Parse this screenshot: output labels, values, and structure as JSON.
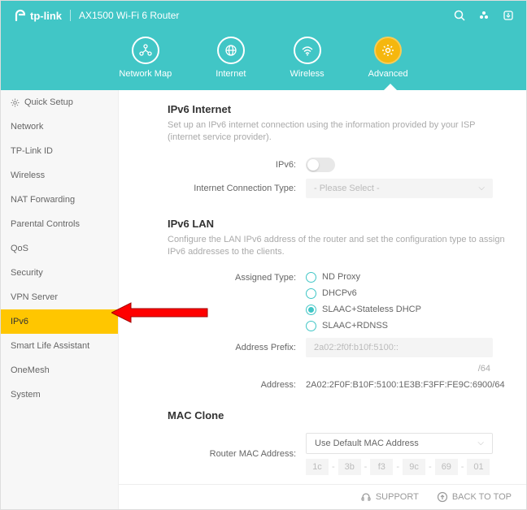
{
  "brand": "tp-link",
  "product": "AX1500 Wi-Fi 6 Router",
  "tabs": {
    "network_map": "Network Map",
    "internet": "Internet",
    "wireless": "Wireless",
    "advanced": "Advanced"
  },
  "sidebar": {
    "items": [
      {
        "label": "Quick Setup",
        "icon": true
      },
      {
        "label": "Network"
      },
      {
        "label": "TP-Link ID"
      },
      {
        "label": "Wireless"
      },
      {
        "label": "NAT Forwarding"
      },
      {
        "label": "Parental Controls"
      },
      {
        "label": "QoS"
      },
      {
        "label": "Security"
      },
      {
        "label": "VPN Server"
      },
      {
        "label": "IPv6",
        "active": true
      },
      {
        "label": "Smart Life Assistant"
      },
      {
        "label": "OneMesh"
      },
      {
        "label": "System"
      }
    ]
  },
  "ipv6_internet": {
    "title": "IPv6 Internet",
    "desc": "Set up an IPv6 internet connection using the information provided by your ISP (internet service provider).",
    "enable_label": "IPv6:",
    "conn_type_label": "Internet Connection Type:",
    "conn_type_value": "- Please Select -"
  },
  "ipv6_lan": {
    "title": "IPv6 LAN",
    "desc": "Configure the LAN IPv6 address of the router and set the configuration type to assign IPv6 addresses to the clients.",
    "assigned_type_label": "Assigned Type:",
    "options": [
      "ND Proxy",
      "DHCPv6",
      "SLAAC+Stateless DHCP",
      "SLAAC+RDNSS"
    ],
    "selected_index": 2,
    "prefix_label": "Address Prefix:",
    "prefix_value": "2a02:2f0f:b10f:5100::",
    "prefix_suffix": "/64",
    "address_label": "Address:",
    "address_value": "2A02:2F0F:B10F:5100:1E3B:F3FF:FE9C:6900/64"
  },
  "mac_clone": {
    "title": "MAC Clone",
    "router_mac_label": "Router MAC Address:",
    "router_mac_value": "Use Default MAC Address",
    "bytes": [
      "1c",
      "3b",
      "f3",
      "9c",
      "69",
      "01"
    ]
  },
  "footer": {
    "support": "SUPPORT",
    "back": "BACK TO TOP"
  }
}
